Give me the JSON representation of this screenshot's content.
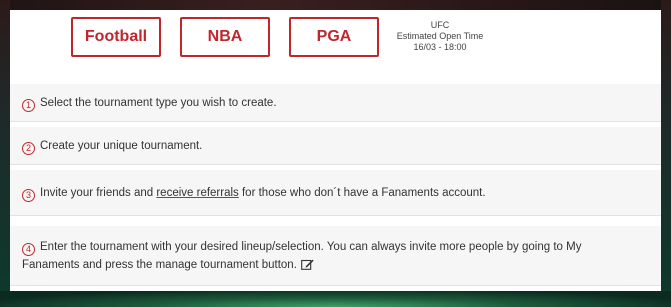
{
  "sport_buttons": [
    {
      "label": "Football"
    },
    {
      "label": "NBA"
    },
    {
      "label": "PGA"
    }
  ],
  "event": {
    "name": "UFC",
    "open_time_label": "Estimated Open Time",
    "open_time": "16/03 - 18:00"
  },
  "steps": [
    {
      "number": "1",
      "text": "Select the tournament type you wish to create."
    },
    {
      "number": "2",
      "text": "Create your unique tournament."
    },
    {
      "number": "3",
      "text_before": "Invite your friends and ",
      "link": "receive referrals",
      "text_after": " for those who don´t have a Fanaments account."
    },
    {
      "number": "4",
      "text": "Enter the tournament with your desired lineup/selection. You can always invite more people by going to My Fanaments and press the manage tournament button."
    }
  ],
  "icons": {
    "step4": "edit-icon"
  },
  "colors": {
    "accent": "#c0272d"
  }
}
